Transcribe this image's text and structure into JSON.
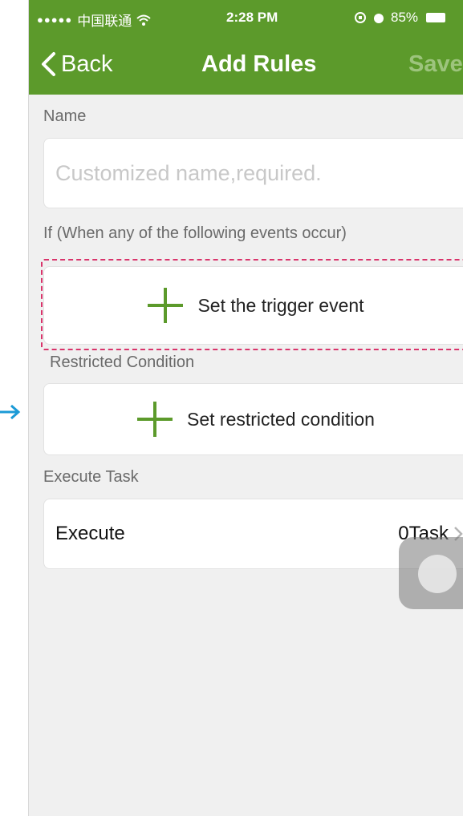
{
  "status_bar": {
    "signal": "●●●●●",
    "carrier": "中国联通",
    "time": "2:28 PM",
    "battery_percent": "85%"
  },
  "nav": {
    "back_label": "Back",
    "title": "Add Rules",
    "save_label": "Save"
  },
  "name_section": {
    "label": "Name",
    "placeholder": "Customized name,required."
  },
  "if_section": {
    "label": "If (When any of the following events occur)",
    "action_label": "Set the trigger event"
  },
  "condition_section": {
    "label": "Restricted Condition",
    "action_label": "Set restricted condition"
  },
  "task_section": {
    "label": "Execute Task",
    "row_label": "Execute",
    "count": "0Task"
  },
  "colors": {
    "brand": "#5c9a2b",
    "dashed_highlight": "#d9346b",
    "annotation_arrow": "#1b9ad6"
  }
}
